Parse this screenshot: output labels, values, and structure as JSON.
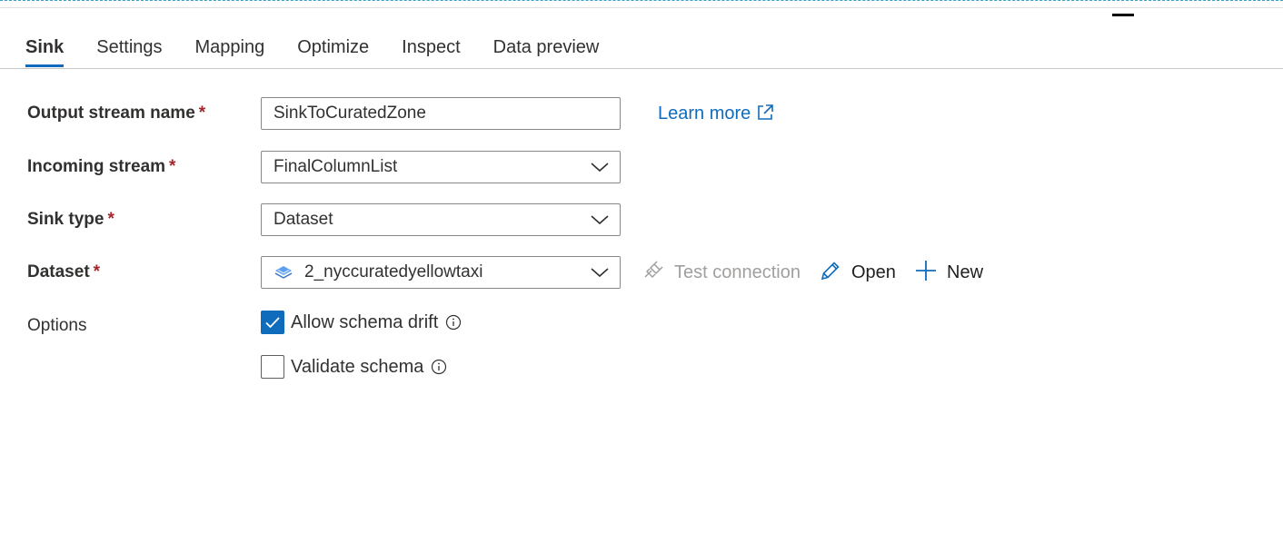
{
  "tabs": [
    {
      "label": "Sink",
      "active": true
    },
    {
      "label": "Settings",
      "active": false
    },
    {
      "label": "Mapping",
      "active": false
    },
    {
      "label": "Optimize",
      "active": false
    },
    {
      "label": "Inspect",
      "active": false
    },
    {
      "label": "Data preview",
      "active": false
    }
  ],
  "form": {
    "output_stream_name": {
      "label": "Output stream name",
      "required_mark": "*",
      "value": "SinkToCuratedZone"
    },
    "incoming_stream": {
      "label": "Incoming stream",
      "required_mark": "*",
      "value": "FinalColumnList"
    },
    "sink_type": {
      "label": "Sink type",
      "required_mark": "*",
      "value": "Dataset"
    },
    "dataset": {
      "label": "Dataset",
      "required_mark": "*",
      "value": "2_nyccuratedyellowtaxi",
      "icon": "dataset-icon"
    },
    "options": {
      "label": "Options"
    }
  },
  "links": {
    "learn_more": "Learn more"
  },
  "actions": {
    "test_connection": "Test connection",
    "open": "Open",
    "new": "New"
  },
  "checkboxes": {
    "allow_schema_drift": {
      "label": "Allow schema drift",
      "checked": true
    },
    "validate_schema": {
      "label": "Validate schema",
      "checked": false
    }
  },
  "colors": {
    "accent": "#0f6cbd",
    "required": "#a4262c",
    "disabled_text": "#a19f9d"
  }
}
